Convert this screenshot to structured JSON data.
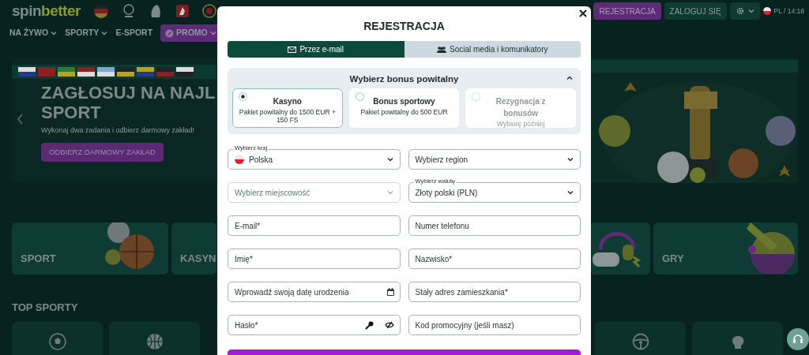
{
  "header": {
    "logo": {
      "first": "spin",
      "second": "better"
    },
    "nav": [
      {
        "label": "NA ŻYWO",
        "kind": "link",
        "dropdown": true
      },
      {
        "label": "SPORTY",
        "kind": "link",
        "dropdown": true
      },
      {
        "label": "E-SPORT",
        "kind": "link",
        "dropdown": false
      },
      {
        "label": "PROMO",
        "kind": "promo",
        "dropdown": true
      }
    ],
    "register_button": "REJESTRACJA",
    "login_button": "ZALOGUJ SIĘ",
    "locale": "PL / 14:18"
  },
  "hero": {
    "title": "ZAGŁOSUJ NA NAJL",
    "title_line2": "SPORT",
    "subtitle": "Wykonaj dwa zadania i odbierz darmowy zakład!",
    "button": "ODBIERZ DARMOWY ZAKŁAD"
  },
  "categories": [
    {
      "label": "SPORT"
    },
    {
      "label": "KASYN"
    },
    {
      "label": "GRY"
    }
  ],
  "top_sports": {
    "title": "TOP SPORTY"
  },
  "modal": {
    "title": "REJESTRACJA",
    "tabs": [
      {
        "label": "Przez e-mail",
        "kind": "email",
        "selected": true
      },
      {
        "label": "Social media i komunikatory",
        "kind": "social",
        "selected": false
      }
    ],
    "bonus": {
      "title": "Wybierz bonus powitalny",
      "expanded": true,
      "options": [
        {
          "title": "Kasyno",
          "description": "Pakiet powitalny do 1500 EUR + 150 FS",
          "selected": true,
          "disabled": false
        },
        {
          "title": "Bonus sportowy",
          "description": "Pakiet powitalny do 500 EUR",
          "selected": false,
          "disabled": false
        },
        {
          "title": "Rezygnacja z bonusów",
          "description": "Wybiorę później",
          "selected": false,
          "disabled": true
        }
      ]
    },
    "rows": [
      {
        "fields": [
          {
            "kind": "select",
            "label": "Wybierz kraj",
            "value": "Polska",
            "flag": true,
            "disabled": false
          },
          {
            "kind": "select",
            "placeholder": "Wybierz region",
            "disabled": false
          }
        ]
      },
      {
        "fields": [
          {
            "kind": "select",
            "placeholder": "Wybierz miejscowość",
            "disabled": true
          },
          {
            "kind": "select",
            "label": "Wybierz walutę",
            "value": "Złoty polski (PLN)",
            "disabled": false
          }
        ]
      },
      {
        "fields": [
          {
            "kind": "text",
            "placeholder": "E-mail*",
            "disabled": false
          },
          {
            "kind": "text",
            "placeholder": "Numer telefonu",
            "disabled": false
          }
        ]
      },
      {
        "fields": [
          {
            "kind": "text",
            "placeholder": "Imię*",
            "disabled": false
          },
          {
            "kind": "text",
            "placeholder": "Nazwisko*",
            "disabled": false
          }
        ]
      },
      {
        "fields": [
          {
            "kind": "date",
            "placeholder": "Wprowadź swoją datę urodzenia",
            "disabled": false
          },
          {
            "kind": "text",
            "placeholder": "Stały adres zamieszkania*",
            "disabled": false
          }
        ]
      },
      {
        "fields": [
          {
            "kind": "password",
            "placeholder": "Hasło*",
            "disabled": false
          },
          {
            "kind": "text",
            "placeholder": "Kod promocyjny (jeśli masz)",
            "disabled": false
          }
        ]
      }
    ]
  }
}
